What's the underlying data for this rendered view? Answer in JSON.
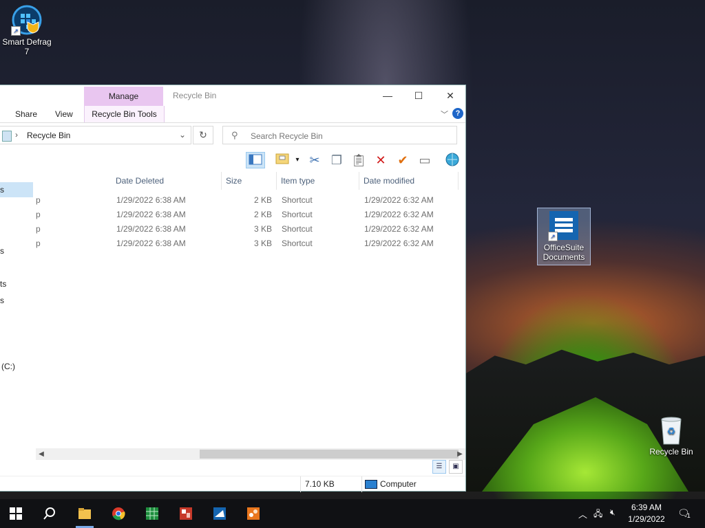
{
  "desktop": {
    "icons": [
      {
        "label": "Smart Defrag 7"
      },
      {
        "label": "OfficeSuite Documents"
      },
      {
        "label": "Recycle Bin"
      }
    ]
  },
  "window": {
    "title": "Recycle Bin",
    "manage_tab": "Manage",
    "ribbon_tabs": [
      "Share",
      "View"
    ],
    "context_tab": "Recycle Bin Tools",
    "address": {
      "crumb": "Recycle Bin"
    },
    "search": {
      "placeholder": "Search Recycle Bin"
    },
    "nav_items": [
      "s",
      "s",
      "ts",
      "s",
      "(C:)"
    ],
    "columns": [
      "Date Deleted",
      "Size",
      "Item type",
      "Date modified"
    ],
    "rows": [
      {
        "name": "p",
        "date_deleted": "1/29/2022 6:38 AM",
        "size": "2 KB",
        "type": "Shortcut",
        "date_modified": "1/29/2022 6:32 AM"
      },
      {
        "name": "p",
        "date_deleted": "1/29/2022 6:38 AM",
        "size": "2 KB",
        "type": "Shortcut",
        "date_modified": "1/29/2022 6:32 AM"
      },
      {
        "name": "p",
        "date_deleted": "1/29/2022 6:38 AM",
        "size": "3 KB",
        "type": "Shortcut",
        "date_modified": "1/29/2022 6:32 AM"
      },
      {
        "name": "p",
        "date_deleted": "1/29/2022 6:38 AM",
        "size": "3 KB",
        "type": "Shortcut",
        "date_modified": "1/29/2022 6:32 AM"
      }
    ],
    "status": {
      "size": "7.10 KB",
      "location": "Computer"
    }
  },
  "taskbar": {
    "time": "6:39 AM",
    "date": "1/29/2022",
    "notification_count": "1"
  },
  "colors": {
    "accent": "#1e66c8",
    "manage": "#e9c6f0",
    "taskbar": "#101114"
  }
}
